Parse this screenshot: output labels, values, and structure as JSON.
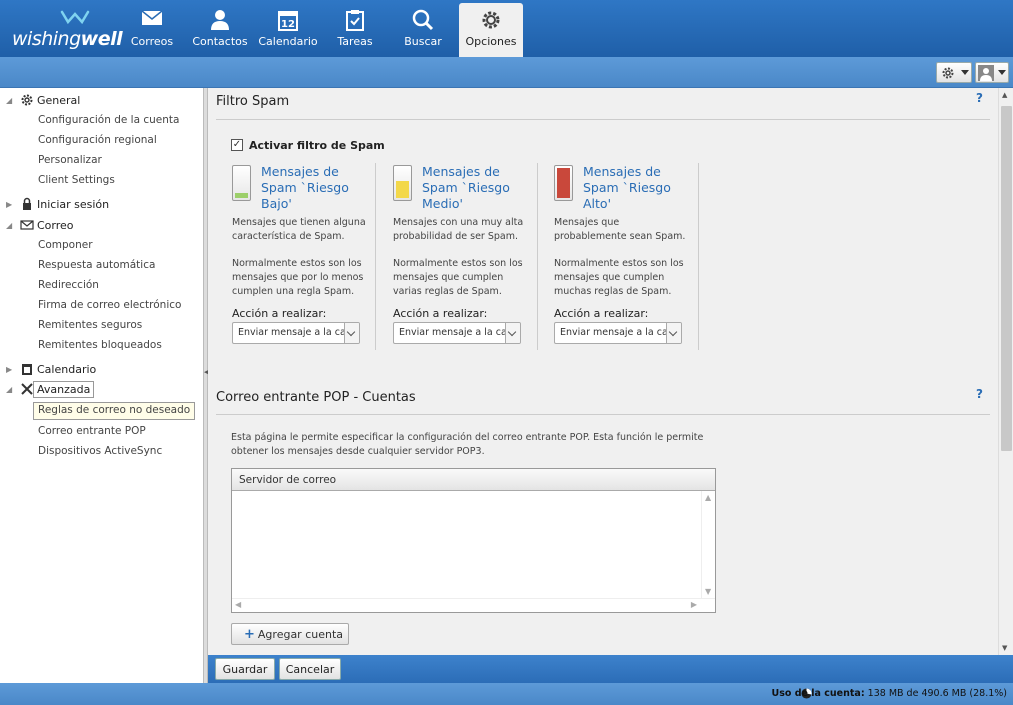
{
  "brand": {
    "logo_text_1": "wishing",
    "logo_text_2": "well"
  },
  "nav": {
    "items": [
      {
        "label": "Correos",
        "icon": "envelope-icon"
      },
      {
        "label": "Contactos",
        "icon": "person-icon"
      },
      {
        "label": "Calendario",
        "icon": "calendar-icon"
      },
      {
        "label": "Tareas",
        "icon": "clipboard-check-icon"
      },
      {
        "label": "Buscar",
        "icon": "search-icon"
      },
      {
        "label": "Opciones",
        "icon": "gear-icon",
        "active": true
      }
    ],
    "calendar_day": "12"
  },
  "sidebar": {
    "general": {
      "label": "General",
      "items": [
        "Configuración de la cuenta",
        "Configuración regional",
        "Personalizar",
        "Client Settings"
      ]
    },
    "login": {
      "label": "Iniciar sesión"
    },
    "mail": {
      "label": "Correo",
      "items": [
        "Componer",
        "Respuesta automática",
        "Redirección",
        "Firma de correo electrónico",
        "Remitentes seguros",
        "Remitentes bloqueados"
      ]
    },
    "calendar": {
      "label": "Calendario"
    },
    "advanced": {
      "label": "Avanzada",
      "items": [
        "Reglas de correo no deseado",
        "Correo entrante POP",
        "Dispositivos ActiveSync"
      ]
    }
  },
  "spam": {
    "title": "Filtro Spam",
    "help": "?",
    "enable_label": "Activar filtro de Spam",
    "enabled": true,
    "columns": [
      {
        "heading": "Mensajes de Spam `Riesgo Bajo'",
        "desc": "Mensajes que tienen alguna característica de Spam.",
        "note": "Normalmente estos son los mensajes que por lo menos cumplen una regla Spam.",
        "action_label": "Acción a realizar:",
        "action_value": "Enviar mensaje a la carpeta",
        "meter_color": "#9ccf6a",
        "meter_level": 0.15
      },
      {
        "heading": "Mensajes de Spam `Riesgo Medio'",
        "desc": "Mensajes con una muy alta probabilidad de ser Spam.",
        "note": "Normalmente estos son los mensajes que cumplen varias reglas de Spam.",
        "action_label": "Acción a realizar:",
        "action_value": "Enviar mensaje a la carpeta",
        "meter_color": "#f3d84a",
        "meter_level": 0.55
      },
      {
        "heading": "Mensajes de Spam `Riesgo Alto'",
        "desc": "Mensajes que probablemente sean Spam.",
        "note": "Normalmente estos son los mensajes que cumplen muchas reglas de Spam.",
        "action_label": "Acción a realizar:",
        "action_value": "Enviar mensaje a la carpeta",
        "meter_color": "#c9483b",
        "meter_level": 1.0
      }
    ]
  },
  "pop": {
    "title": "Correo entrante POP - Cuentas",
    "help": "?",
    "desc": "Esta página le permite especificar la configuración del correo entrante POP. Esta función le permite obtener los mensajes desde cualquier servidor POP3.",
    "grid_header": "Servidor de correo",
    "add_label": "Agregar cuenta"
  },
  "actions": {
    "save": "Guardar",
    "cancel": "Cancelar"
  },
  "status": {
    "usage_label": "Uso de la cuenta:",
    "usage_value": "138 MB de 490.6 MB (28.1%)",
    "usage_fraction": 0.281
  }
}
